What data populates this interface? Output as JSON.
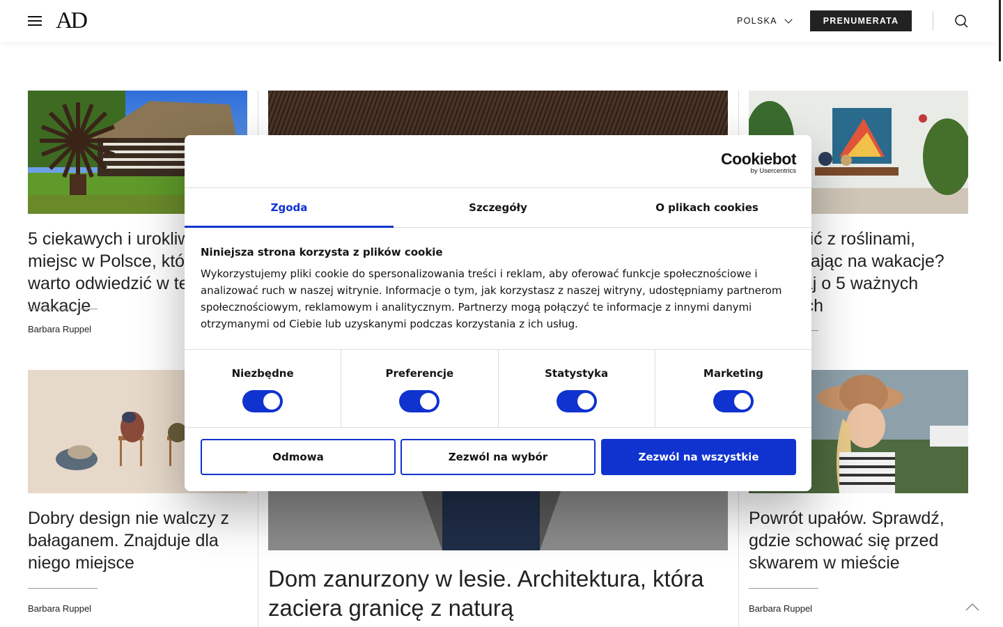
{
  "header": {
    "logo": "AD",
    "language": "POLSKA",
    "subscribe_label": "PRENUMERATA"
  },
  "articles": {
    "left_top": {
      "title": "5 ciekawych i urokliwych miejsc w Polsce, które warto odwiedzić w te wakacje",
      "author": "Barbara Ruppel"
    },
    "left_bottom": {
      "title": "Dobry design nie walczy z bałaganem. Znajduje dla niego miejsce",
      "author": "Barbara Ruppel"
    },
    "center": {
      "title": "Dom zanurzony w lesie. Architektura, która zaciera granicę z naturą"
    },
    "right_top": {
      "title": "Co zrobić z roślinami, wyjeżdżając na wakacje? Pamiętaj o 5 ważnych zasadach"
    },
    "right_bottom": {
      "title": "Powrót upałów. Sprawdź, gdzie schować się przed skwarem w mieście",
      "author": "Barbara Ruppel"
    }
  },
  "cookie": {
    "logo_main": "Cookiebot",
    "logo_sub": "by Usercentrics",
    "tabs": [
      "Zgoda",
      "Szczegóły",
      "O plikach cookies"
    ],
    "heading": "Niniejsza strona korzysta z plików cookie",
    "body": "Wykorzystujemy pliki cookie do spersonalizowania treści i reklam, aby oferować funkcje społecznościowe i analizować ruch w naszej witrynie. Informacje o tym, jak korzystasz z naszej witryny, udostępniamy partnerom społecznościowym, reklamowym i analitycznym. Partnerzy mogą połączyć te informacje z innymi danymi otrzymanymi od Ciebie lub uzyskanymi podczas korzystania z ich usług.",
    "categories": [
      {
        "label": "Niezbędne",
        "enabled": true
      },
      {
        "label": "Preferencje",
        "enabled": true
      },
      {
        "label": "Statystyka",
        "enabled": true
      },
      {
        "label": "Marketing",
        "enabled": true
      }
    ],
    "buttons": {
      "deny": "Odmowa",
      "allow_selection": "Zezwól na wybór",
      "allow_all": "Zezwól na wszystkie"
    },
    "accent_color": "#1032cf"
  }
}
